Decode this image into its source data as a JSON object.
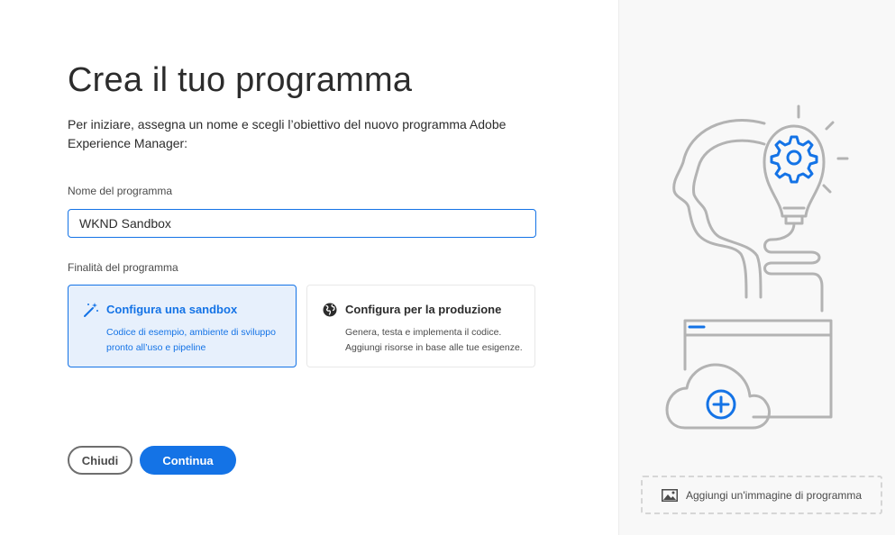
{
  "page": {
    "title": "Crea il tuo programma",
    "intro": "Per iniziare, assegna un nome e scegli l’obiettivo del nuovo programma Adobe Experience Manager:"
  },
  "name_field": {
    "label": "Nome del programma",
    "value": "WKND Sandbox"
  },
  "purpose": {
    "label": "Finalità del programma",
    "options": [
      {
        "title": "Configura una sandbox",
        "description": "Codice di esempio, ambiente di sviluppo pronto all’uso e pipeline",
        "icon": "magic-wand-icon",
        "selected": true
      },
      {
        "title": "Configura per la produzione",
        "description": "Genera, testa e implementa il codice. Aggiungi risorse in base alle tue esigenze.",
        "icon": "globe-icon",
        "selected": false
      }
    ]
  },
  "buttons": {
    "close_label": "Chiudi",
    "continue_label": "Continua"
  },
  "illustration": {
    "icon": "head-lightbulb-cloud-illustration"
  },
  "add_image": {
    "label": "Aggiungi un'immagine di programma",
    "icon": "image-icon"
  },
  "colors": {
    "accent": "#1473e6",
    "selected_bg": "#e7f0fc",
    "illustration_gray": "#b3b3b3"
  }
}
